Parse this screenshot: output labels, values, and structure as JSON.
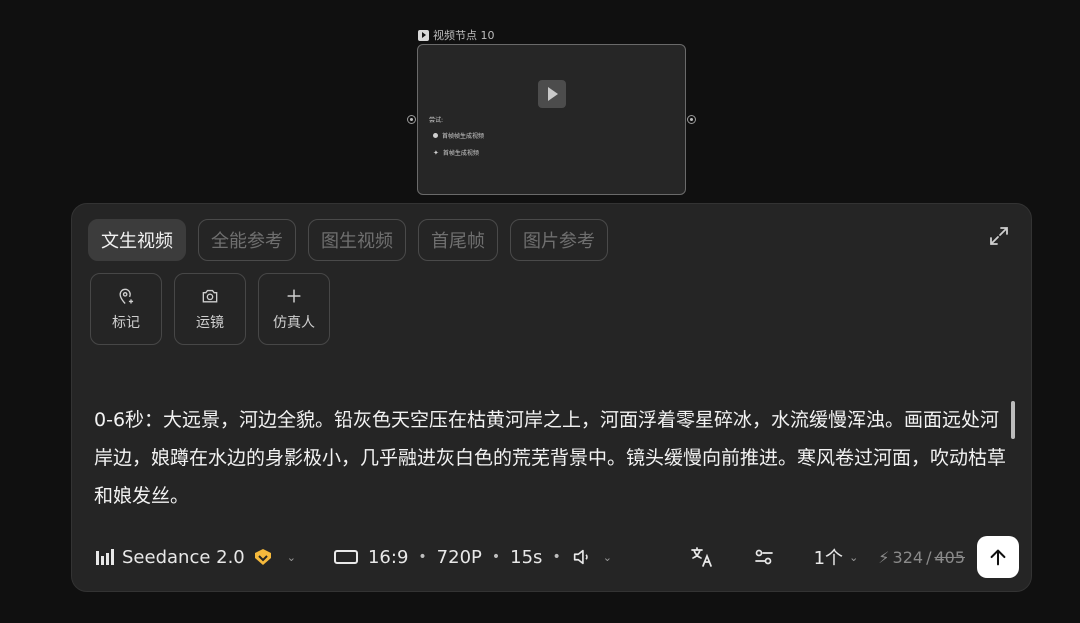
{
  "canvas": {
    "node": {
      "title": "视频节点 10",
      "try_label": "尝试:",
      "options": [
        "首帧帧生成视频",
        "首帧生成视频"
      ]
    }
  },
  "panel": {
    "tabs": [
      {
        "label": "文生视频",
        "active": true
      },
      {
        "label": "全能参考",
        "active": false
      },
      {
        "label": "图生视频",
        "active": false
      },
      {
        "label": "首尾帧",
        "active": false
      },
      {
        "label": "图片参考",
        "active": false
      }
    ],
    "tools": [
      {
        "label": "标记",
        "icon": "location-pin-icon"
      },
      {
        "label": "运镜",
        "icon": "camera-icon"
      },
      {
        "label": "仿真人",
        "icon": "plus-icon"
      }
    ],
    "prompt": "0-6秒：大远景，河边全貌。铅灰色天空压在枯黄河岸之上，河面浮着零星碎冰，水流缓慢浑浊。画面远处河岸边，娘蹲在水边的身影极小，几乎融进灰白色的荒芜背景中。镜头缓慢向前推进。寒风卷过河面，吹动枯草和娘发丝。",
    "bottom": {
      "model": "Seedance 2.0",
      "aspect_ratio": "16:9",
      "resolution": "720P",
      "duration": "15s",
      "count": "1个",
      "credits": "324",
      "credits_separator": "/",
      "credits_original": "405"
    }
  },
  "colors": {
    "background": "#101010",
    "panel": "#252525",
    "badge": "#f5b93c",
    "send_button": "#ffffff"
  }
}
